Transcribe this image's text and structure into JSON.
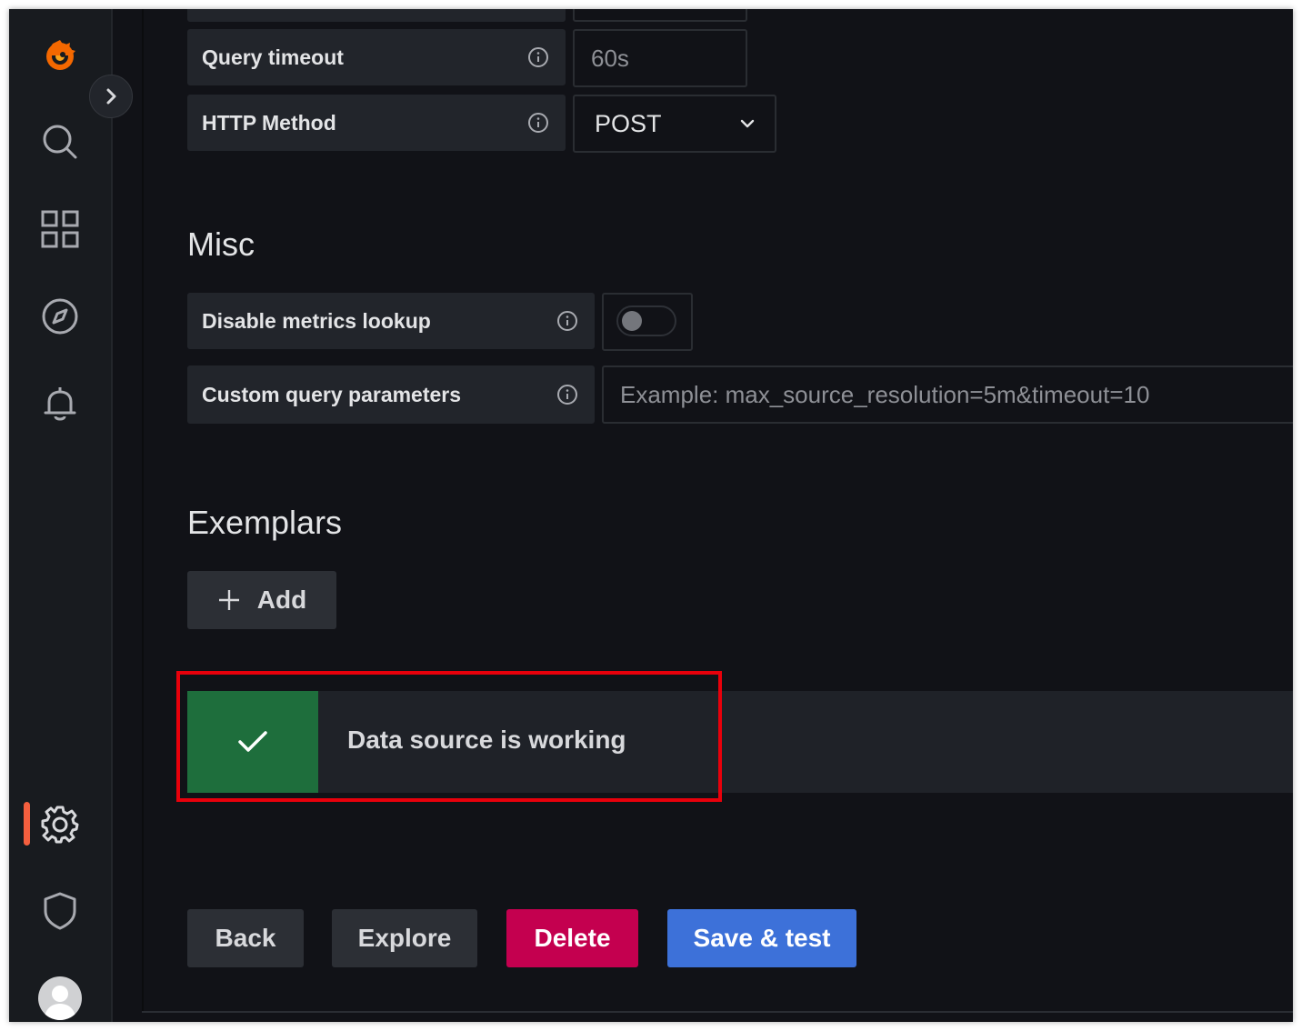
{
  "colors": {
    "background": "#111217",
    "sidebar": "#181b1f",
    "accent_orange": "#f55f3e",
    "success_green": "#1e6e3c",
    "danger": "#c4004f",
    "primary": "#3d71d9",
    "highlight_red": "#e8000b"
  },
  "sidebar": {
    "items": [
      {
        "icon": "grafana-logo-icon"
      },
      {
        "icon": "search-icon"
      },
      {
        "icon": "dashboards-grid-icon"
      },
      {
        "icon": "explore-compass-icon"
      },
      {
        "icon": "alerting-bell-icon"
      },
      {
        "icon": "configuration-gear-icon",
        "active": true
      },
      {
        "icon": "server-admin-shield-icon"
      },
      {
        "icon": "user-avatar-icon"
      }
    ],
    "expand_icon": "chevron-right-icon"
  },
  "http": {
    "query_timeout": {
      "label": "Query timeout",
      "placeholder": "60s"
    },
    "http_method": {
      "label": "HTTP Method",
      "value": "POST"
    }
  },
  "misc": {
    "title": "Misc",
    "disable_metrics_lookup": {
      "label": "Disable metrics lookup",
      "enabled": false
    },
    "custom_query_parameters": {
      "label": "Custom query parameters",
      "placeholder": "Example: max_source_resolution=5m&timeout=10"
    }
  },
  "exemplars": {
    "title": "Exemplars",
    "add_label": "Add"
  },
  "alert": {
    "message": "Data source is working",
    "status": "success"
  },
  "actions": {
    "back": "Back",
    "explore": "Explore",
    "delete": "Delete",
    "save_test": "Save & test"
  }
}
